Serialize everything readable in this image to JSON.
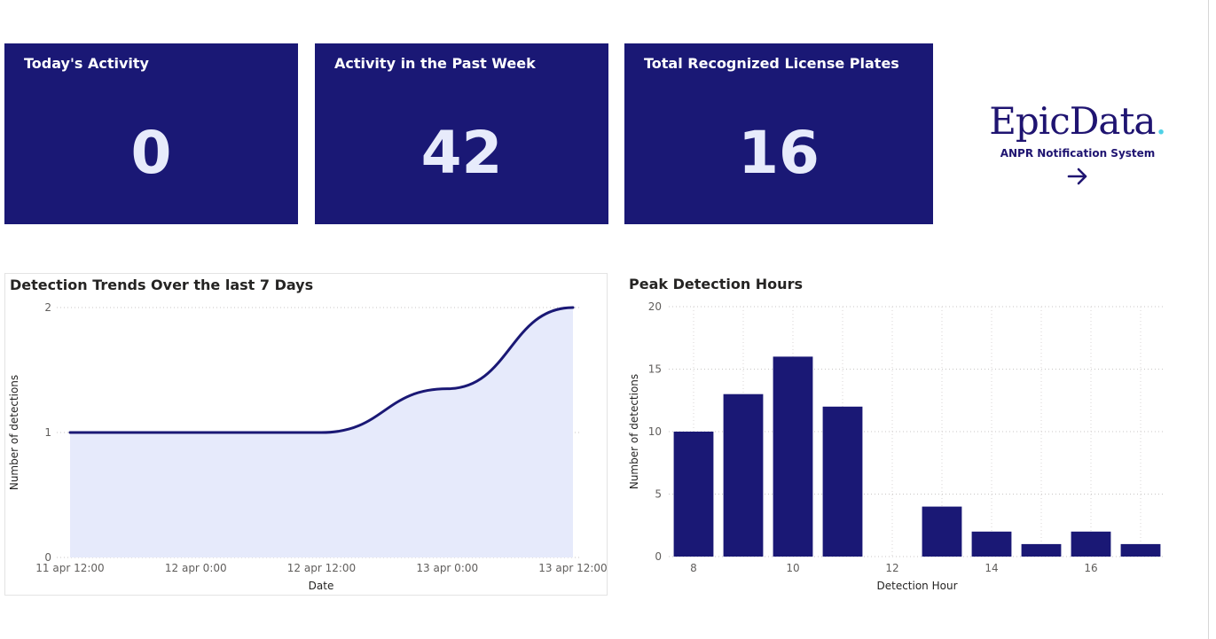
{
  "kpis": {
    "today": {
      "title": "Today's Activity",
      "value": "0"
    },
    "week": {
      "title": "Activity in the Past Week",
      "value": "42"
    },
    "total": {
      "title": "Total Recognized License Plates",
      "value": "16"
    }
  },
  "brand": {
    "logo_text": "EpicData",
    "logo_dot": ".",
    "subtitle": "ANPR Notification System",
    "arrow_icon": "arrow-right-icon"
  },
  "colors": {
    "kpi_bg": "#1a1875",
    "kpi_value": "#e7ebfb",
    "line": "#1a1875",
    "area_fill": "#e6eafb",
    "bar": "#1a1875",
    "brand_dot": "#4fd1e6"
  },
  "chart_data": [
    {
      "type": "area",
      "title": "Detection Trends Over the last 7 Days",
      "xlabel": "Date",
      "ylabel": "Number of detections",
      "x_ticks": [
        "11 apr 12:00",
        "12 apr 0:00",
        "12 apr 12:00",
        "13 apr 0:00",
        "13 apr 12:00"
      ],
      "ylim": [
        0,
        2
      ],
      "y_ticks": [
        0,
        1,
        2
      ],
      "x": [
        "11 apr 12:00",
        "12 apr 0:00",
        "12 apr 12:00",
        "13 apr 0:00",
        "13 apr 12:00"
      ],
      "values": [
        1,
        1,
        1,
        1.35,
        2
      ],
      "grid": "horizontal dotted"
    },
    {
      "type": "bar",
      "title": "Peak Detection Hours",
      "xlabel": "Detection Hour",
      "ylabel": "Number of detections",
      "x_ticks": [
        8,
        10,
        12,
        14,
        16
      ],
      "ylim": [
        0,
        20
      ],
      "y_ticks": [
        0,
        5,
        10,
        15,
        20
      ],
      "x": [
        8,
        9,
        10,
        11,
        13,
        14,
        15,
        16,
        17
      ],
      "values": [
        10,
        13,
        16,
        12,
        4,
        2,
        1,
        2,
        1
      ],
      "grid": "both dotted"
    }
  ]
}
